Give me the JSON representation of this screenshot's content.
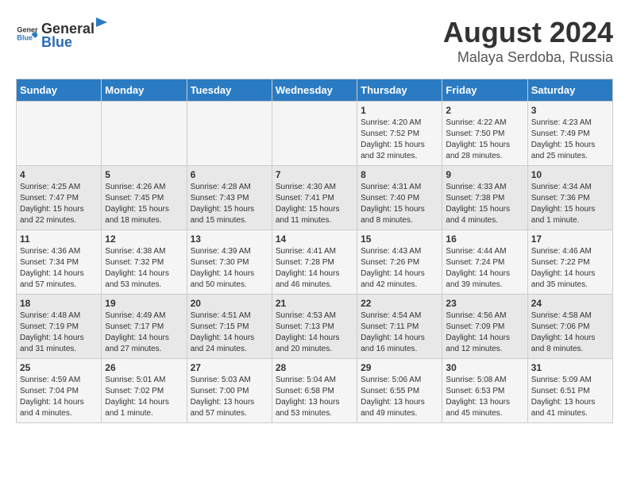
{
  "header": {
    "logo_general": "General",
    "logo_blue": "Blue",
    "month_year": "August 2024",
    "location": "Malaya Serdoba, Russia"
  },
  "weekdays": [
    "Sunday",
    "Monday",
    "Tuesday",
    "Wednesday",
    "Thursday",
    "Friday",
    "Saturday"
  ],
  "weeks": [
    [
      {
        "day": "",
        "info": ""
      },
      {
        "day": "",
        "info": ""
      },
      {
        "day": "",
        "info": ""
      },
      {
        "day": "",
        "info": ""
      },
      {
        "day": "1",
        "info": "Sunrise: 4:20 AM\nSunset: 7:52 PM\nDaylight: 15 hours\nand 32 minutes."
      },
      {
        "day": "2",
        "info": "Sunrise: 4:22 AM\nSunset: 7:50 PM\nDaylight: 15 hours\nand 28 minutes."
      },
      {
        "day": "3",
        "info": "Sunrise: 4:23 AM\nSunset: 7:49 PM\nDaylight: 15 hours\nand 25 minutes."
      }
    ],
    [
      {
        "day": "4",
        "info": "Sunrise: 4:25 AM\nSunset: 7:47 PM\nDaylight: 15 hours\nand 22 minutes."
      },
      {
        "day": "5",
        "info": "Sunrise: 4:26 AM\nSunset: 7:45 PM\nDaylight: 15 hours\nand 18 minutes."
      },
      {
        "day": "6",
        "info": "Sunrise: 4:28 AM\nSunset: 7:43 PM\nDaylight: 15 hours\nand 15 minutes."
      },
      {
        "day": "7",
        "info": "Sunrise: 4:30 AM\nSunset: 7:41 PM\nDaylight: 15 hours\nand 11 minutes."
      },
      {
        "day": "8",
        "info": "Sunrise: 4:31 AM\nSunset: 7:40 PM\nDaylight: 15 hours\nand 8 minutes."
      },
      {
        "day": "9",
        "info": "Sunrise: 4:33 AM\nSunset: 7:38 PM\nDaylight: 15 hours\nand 4 minutes."
      },
      {
        "day": "10",
        "info": "Sunrise: 4:34 AM\nSunset: 7:36 PM\nDaylight: 15 hours\nand 1 minute."
      }
    ],
    [
      {
        "day": "11",
        "info": "Sunrise: 4:36 AM\nSunset: 7:34 PM\nDaylight: 14 hours\nand 57 minutes."
      },
      {
        "day": "12",
        "info": "Sunrise: 4:38 AM\nSunset: 7:32 PM\nDaylight: 14 hours\nand 53 minutes."
      },
      {
        "day": "13",
        "info": "Sunrise: 4:39 AM\nSunset: 7:30 PM\nDaylight: 14 hours\nand 50 minutes."
      },
      {
        "day": "14",
        "info": "Sunrise: 4:41 AM\nSunset: 7:28 PM\nDaylight: 14 hours\nand 46 minutes."
      },
      {
        "day": "15",
        "info": "Sunrise: 4:43 AM\nSunset: 7:26 PM\nDaylight: 14 hours\nand 42 minutes."
      },
      {
        "day": "16",
        "info": "Sunrise: 4:44 AM\nSunset: 7:24 PM\nDaylight: 14 hours\nand 39 minutes."
      },
      {
        "day": "17",
        "info": "Sunrise: 4:46 AM\nSunset: 7:22 PM\nDaylight: 14 hours\nand 35 minutes."
      }
    ],
    [
      {
        "day": "18",
        "info": "Sunrise: 4:48 AM\nSunset: 7:19 PM\nDaylight: 14 hours\nand 31 minutes."
      },
      {
        "day": "19",
        "info": "Sunrise: 4:49 AM\nSunset: 7:17 PM\nDaylight: 14 hours\nand 27 minutes."
      },
      {
        "day": "20",
        "info": "Sunrise: 4:51 AM\nSunset: 7:15 PM\nDaylight: 14 hours\nand 24 minutes."
      },
      {
        "day": "21",
        "info": "Sunrise: 4:53 AM\nSunset: 7:13 PM\nDaylight: 14 hours\nand 20 minutes."
      },
      {
        "day": "22",
        "info": "Sunrise: 4:54 AM\nSunset: 7:11 PM\nDaylight: 14 hours\nand 16 minutes."
      },
      {
        "day": "23",
        "info": "Sunrise: 4:56 AM\nSunset: 7:09 PM\nDaylight: 14 hours\nand 12 minutes."
      },
      {
        "day": "24",
        "info": "Sunrise: 4:58 AM\nSunset: 7:06 PM\nDaylight: 14 hours\nand 8 minutes."
      }
    ],
    [
      {
        "day": "25",
        "info": "Sunrise: 4:59 AM\nSunset: 7:04 PM\nDaylight: 14 hours\nand 4 minutes."
      },
      {
        "day": "26",
        "info": "Sunrise: 5:01 AM\nSunset: 7:02 PM\nDaylight: 14 hours\nand 1 minute."
      },
      {
        "day": "27",
        "info": "Sunrise: 5:03 AM\nSunset: 7:00 PM\nDaylight: 13 hours\nand 57 minutes."
      },
      {
        "day": "28",
        "info": "Sunrise: 5:04 AM\nSunset: 6:58 PM\nDaylight: 13 hours\nand 53 minutes."
      },
      {
        "day": "29",
        "info": "Sunrise: 5:06 AM\nSunset: 6:55 PM\nDaylight: 13 hours\nand 49 minutes."
      },
      {
        "day": "30",
        "info": "Sunrise: 5:08 AM\nSunset: 6:53 PM\nDaylight: 13 hours\nand 45 minutes."
      },
      {
        "day": "31",
        "info": "Sunrise: 5:09 AM\nSunset: 6:51 PM\nDaylight: 13 hours\nand 41 minutes."
      }
    ]
  ]
}
